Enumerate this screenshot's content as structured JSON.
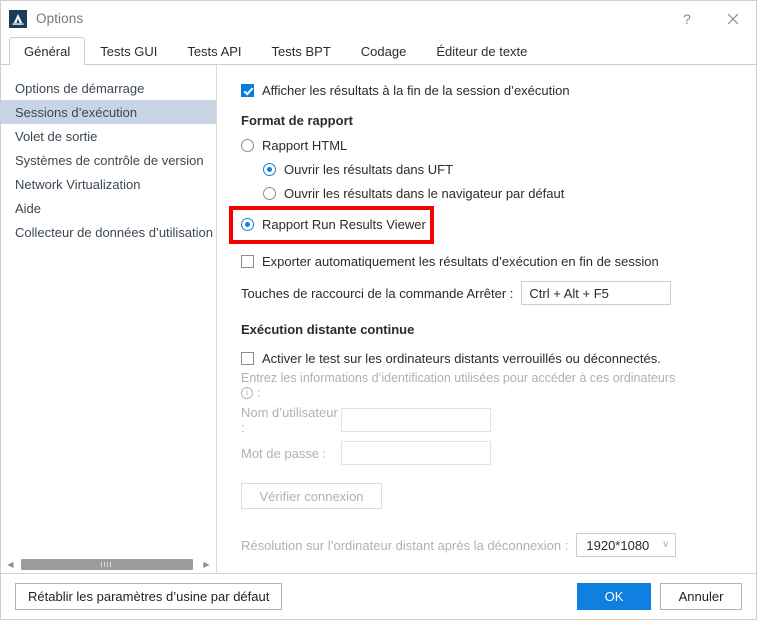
{
  "window": {
    "title": "Options",
    "app_icon": "uft-app-icon",
    "help_icon": "?",
    "close_icon": "✕",
    "accent_color": "#a98fc4",
    "titlebar_accent_dark": "#3b3b46"
  },
  "tabs": [
    {
      "label": "Général",
      "active": true
    },
    {
      "label": "Tests GUI",
      "active": false
    },
    {
      "label": "Tests API",
      "active": false
    },
    {
      "label": "Tests BPT",
      "active": false
    },
    {
      "label": "Codage",
      "active": false
    },
    {
      "label": "Éditeur de texte",
      "active": false
    }
  ],
  "sidebar": {
    "items": [
      {
        "label": "Options de démarrage",
        "selected": false
      },
      {
        "label": "Sessions d’exécution",
        "selected": true
      },
      {
        "label": "Volet de sortie",
        "selected": false
      },
      {
        "label": "Systèmes de contrôle de version",
        "selected": false
      },
      {
        "label": "Network Virtualization",
        "selected": false
      },
      {
        "label": "Aide",
        "selected": false
      },
      {
        "label": "Collecteur de données d’utilisation",
        "selected": false
      }
    ],
    "selected_bg": "#c6d4e4",
    "scrollbar": {
      "left_arrow": "◀",
      "right_arrow": "▶"
    }
  },
  "main": {
    "show_results_checkbox": {
      "label": "Afficher les résultats à la fin de la session d’exécution",
      "checked": true
    },
    "report_format_title": "Format de rapport",
    "report_options": [
      {
        "label": "Rapport HTML",
        "selected": false,
        "indent": 0
      },
      {
        "label": "Ouvrir les résultats dans UFT",
        "selected": true,
        "indent": 1
      },
      {
        "label": "Ouvrir les résultats dans le navigateur par défaut",
        "selected": false,
        "indent": 1
      },
      {
        "label": "Rapport Run Results Viewer",
        "selected": true,
        "indent": 0
      }
    ],
    "auto_export_checkbox": {
      "label": "Exporter automatiquement les résultats d’exécution en fin de session",
      "checked": false
    },
    "stop_shortcut": {
      "label": "Touches de raccourci de la commande Arrêter :",
      "value": "Ctrl + Alt + F5"
    },
    "remote_section_title": "Exécution distante continue",
    "enable_remote_checkbox": {
      "label": "Activer le test sur les ordinateurs distants verrouillés ou déconnectés.",
      "checked": false
    },
    "credentials_hint": "Entrez les informations d’identification utilisées pour accéder à ces ordinateurs",
    "credentials_hint_suffix": ":",
    "username_label": "Nom d’utilisateur :",
    "username_value": "",
    "password_label": "Mot de passe :",
    "password_value": "",
    "verify_connection_button": "Vérifier connexion",
    "resolution_label": "Résolution sur l’ordinateur distant après la déconnexion :",
    "resolution_value": "1920*1080",
    "resolution_chevron": "∨"
  },
  "annotation": {
    "highlight_color": "#f40000",
    "target": "Rapport Run Results Viewer"
  },
  "footer": {
    "restore_defaults": "Rétablir les paramètres d’usine par défaut",
    "ok": "OK",
    "cancel": "Annuler",
    "ok_color": "#0f7fe0"
  }
}
